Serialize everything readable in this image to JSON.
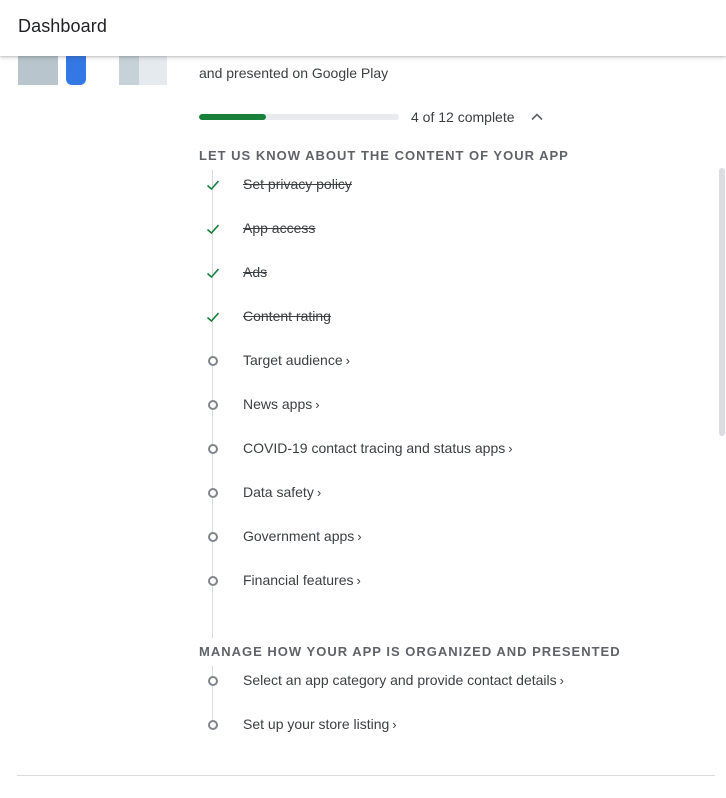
{
  "header": {
    "title": "Dashboard"
  },
  "intro": {
    "description_fragment": "and presented on Google Play"
  },
  "progress": {
    "completed": 4,
    "total": 12,
    "label": "4 of 12 complete"
  },
  "sections": [
    {
      "title": "LET US KNOW ABOUT THE CONTENT OF YOUR APP",
      "tasks": [
        {
          "label": "Set privacy policy",
          "done": true
        },
        {
          "label": "App access",
          "done": true
        },
        {
          "label": "Ads",
          "done": true
        },
        {
          "label": "Content rating",
          "done": true
        },
        {
          "label": "Target audience",
          "done": false
        },
        {
          "label": "News apps",
          "done": false
        },
        {
          "label": "COVID-19 contact tracing and status apps",
          "done": false
        },
        {
          "label": "Data safety",
          "done": false
        },
        {
          "label": "Government apps",
          "done": false
        },
        {
          "label": "Financial features",
          "done": false
        }
      ]
    },
    {
      "title": "MANAGE HOW YOUR APP IS ORGANIZED AND PRESENTED",
      "tasks": [
        {
          "label": "Select an app category and provide contact details",
          "done": false
        },
        {
          "label": "Set up your store listing",
          "done": false
        }
      ]
    }
  ],
  "icons": {
    "done": "check-icon",
    "todo": "circle-outline-icon",
    "navigate": "chevron-right-icon",
    "collapse": "chevron-up-icon"
  },
  "colors": {
    "progress_fill": "#188038",
    "check": "#188038",
    "track": "#e8eaed",
    "section_title": "#5f6368"
  }
}
